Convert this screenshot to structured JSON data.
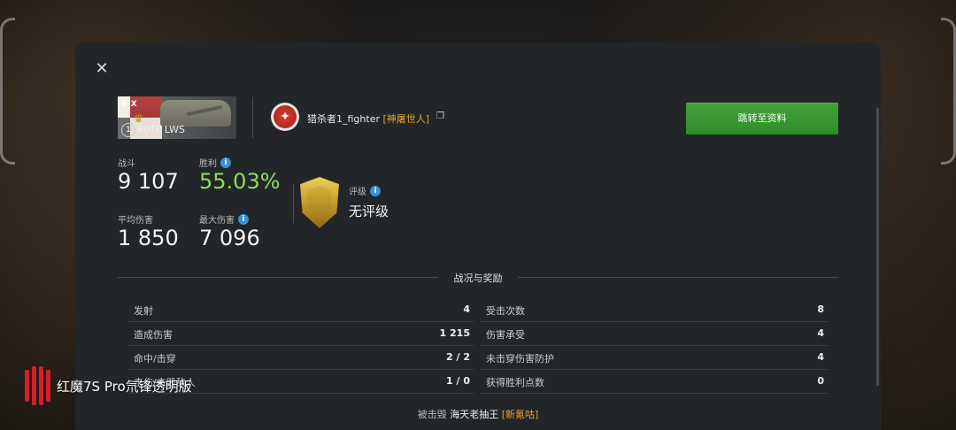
{
  "header": {
    "close_icon": "✕"
  },
  "tank": {
    "tier_mark": "X",
    "level": "1",
    "name": "60TP LWS",
    "flag_colors": [
      "#b2433e",
      "#f2efe9"
    ]
  },
  "player": {
    "name": "猎杀者1_fighter",
    "clan": "[神屠世人]",
    "copy_icon": "copy-icon"
  },
  "actions": {
    "profile_button": "跳转至资料"
  },
  "stats": {
    "battles_label": "战斗",
    "battles_value": "9 107",
    "win_label": "胜利",
    "win_value": "55.03%",
    "avg_damage_label": "平均伤害",
    "avg_damage_value": "1 850",
    "max_damage_label": "最大伤害",
    "max_damage_value": "7 096"
  },
  "rating": {
    "label": "评级",
    "value": "无评级"
  },
  "section": {
    "title": "战况与奖励"
  },
  "table": {
    "left": [
      {
        "label": "发射",
        "value": "4"
      },
      {
        "label": "造成伤害",
        "value": "1 215"
      },
      {
        "label": "命中/击穿",
        "value": "2 / 2"
      },
      {
        "label": "击伤/击毁敌人",
        "value": "1 / 0"
      }
    ],
    "right": [
      {
        "label": "受击次数",
        "value": "8"
      },
      {
        "label": "伤害承受",
        "value": "4"
      },
      {
        "label": "未击穿伤害防护",
        "value": "4"
      },
      {
        "label": "获得胜利点数",
        "value": "0"
      }
    ]
  },
  "footer": {
    "killed_by_label": "被击毁",
    "killer_name": "海天老抽王",
    "killer_clan": "[新氪咕]"
  },
  "watermark": {
    "text": "红魔7S Pro氘锋透明版"
  },
  "colors": {
    "accent_green": "#43a33a",
    "win_green": "#8fdc5e",
    "clan_orange": "#f0a030",
    "info_blue": "#3a8fd0"
  }
}
